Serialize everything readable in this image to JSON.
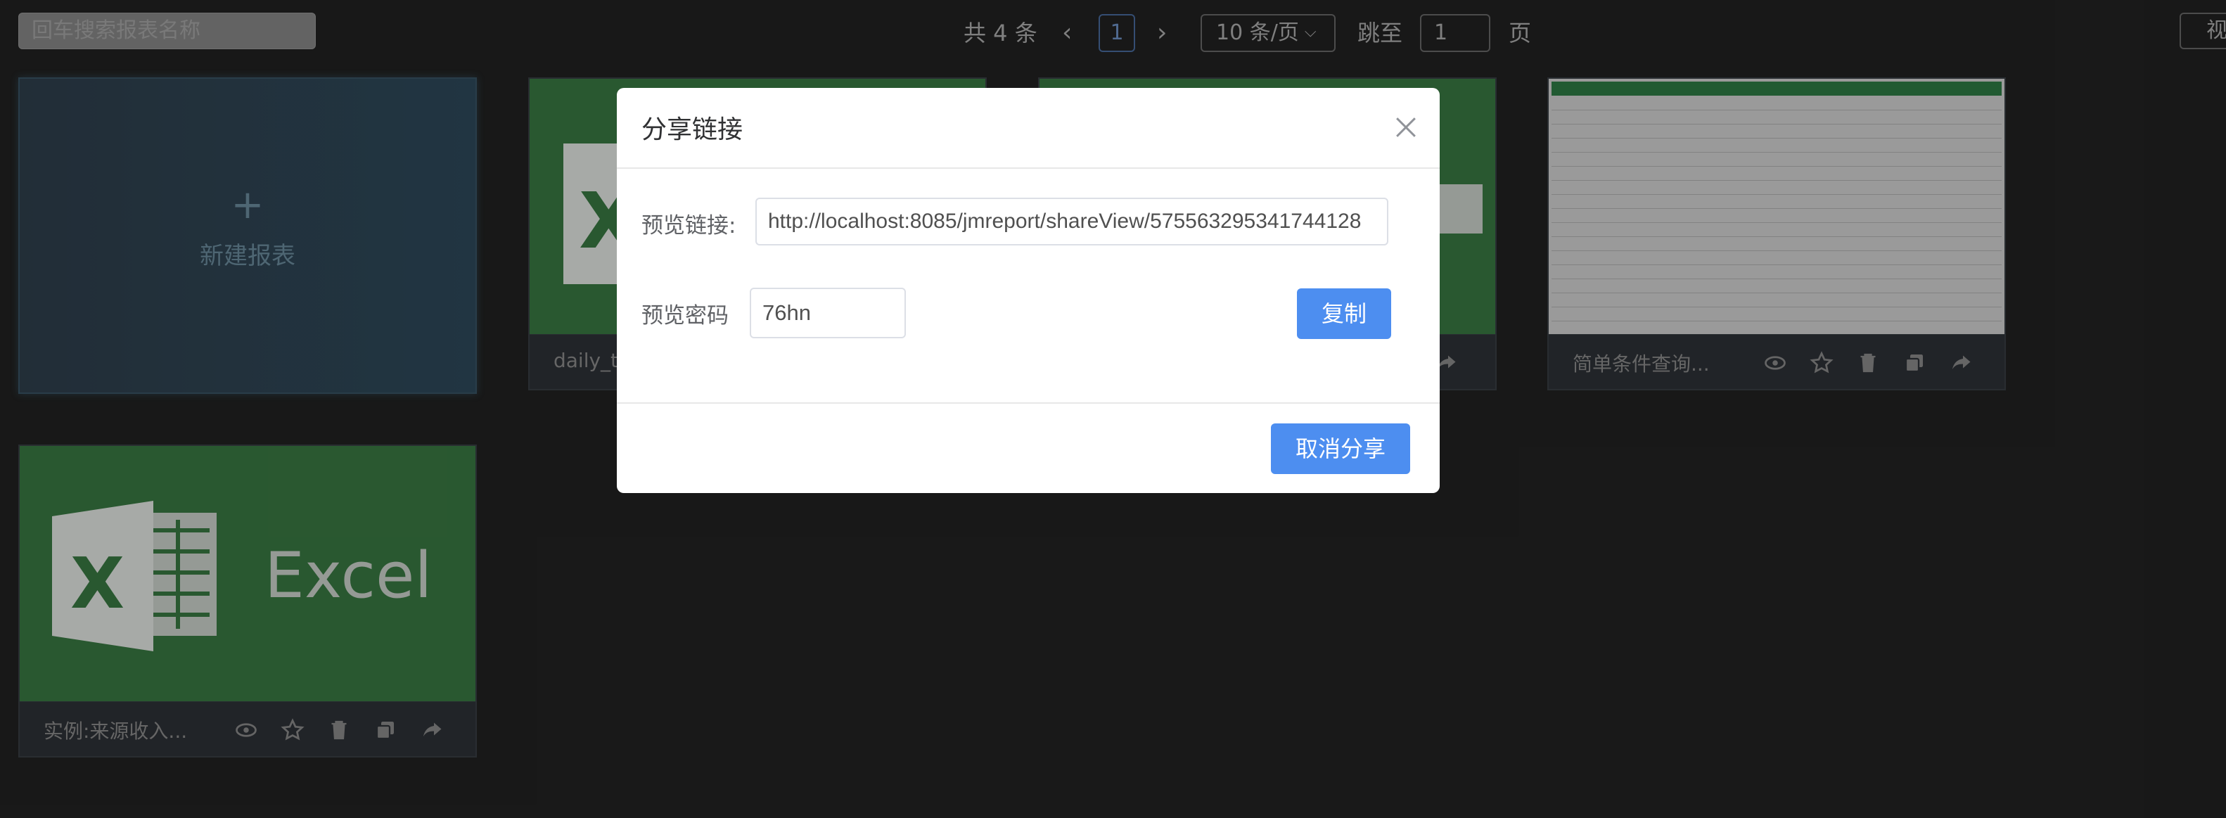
{
  "toolbar": {
    "search_placeholder": "回车搜索报表名称"
  },
  "pagination": {
    "total_label": "共 4 条",
    "current_page": "1",
    "page_size_label": "10 条/页",
    "jump_label": "跳至",
    "jump_value": "1",
    "page_suffix": "页"
  },
  "view_button_label": "视",
  "new_report": {
    "plus": "+",
    "label": "新建报表"
  },
  "cards": [
    {
      "title": "daily_t",
      "thumbnail": "excel"
    },
    {
      "title": "",
      "thumbnail": "excel"
    },
    {
      "title": "简单条件查询...",
      "thumbnail": "spreadsheet-preview"
    },
    {
      "title": "实例:来源收入...",
      "thumbnail": "excel",
      "thumb_text": "Excel"
    }
  ],
  "card_actions": [
    "eye-icon",
    "star-icon",
    "trash-icon",
    "copy-icon",
    "share-icon"
  ],
  "share_dialog": {
    "title": "分享链接",
    "link_label": "预览链接:",
    "link_value": "http://localhost:8085/jmreport/shareView/575563295341744128",
    "password_label": "预览密码",
    "password_value": "76hn",
    "copy_button": "复制",
    "cancel_button": "取消分享"
  },
  "colors": {
    "background": "#222222",
    "excel_green": "#3a7a43",
    "primary_button": "#4d8ef0"
  }
}
